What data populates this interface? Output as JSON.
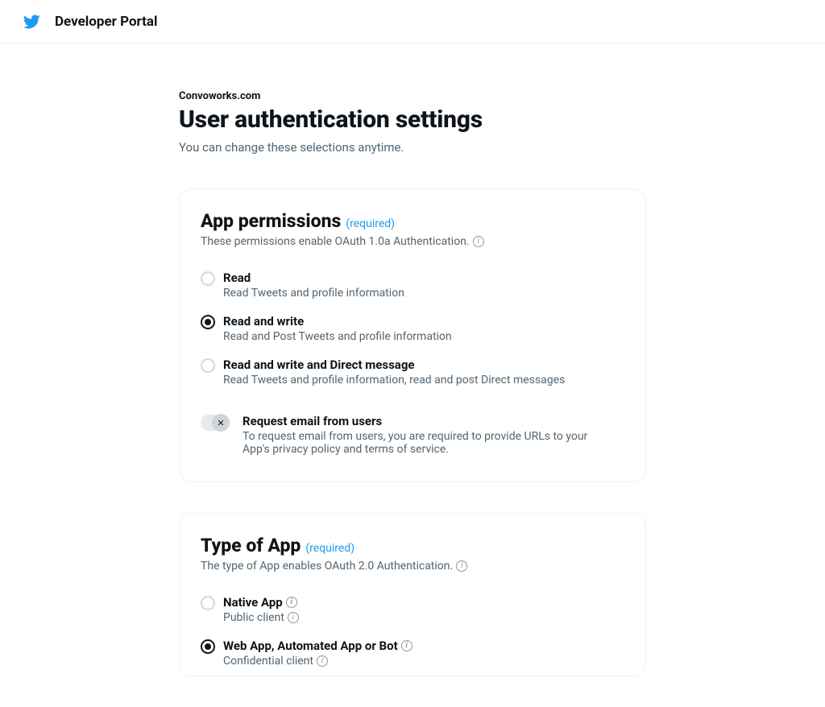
{
  "header": {
    "portal_title": "Developer Portal"
  },
  "page": {
    "breadcrumb": "Convoworks.com",
    "title": "User authentication settings",
    "subtitle": "You can change these selections anytime."
  },
  "sections": {
    "app_permissions": {
      "title": "App permissions",
      "required": "(required)",
      "description": "These permissions enable OAuth 1.0a Authentication.",
      "options": [
        {
          "label": "Read",
          "description": "Read Tweets and profile information",
          "selected": false
        },
        {
          "label": "Read and write",
          "description": "Read and Post Tweets and profile information",
          "selected": true
        },
        {
          "label": "Read and write and Direct message",
          "description": "Read Tweets and profile information, read and post Direct messages",
          "selected": false
        }
      ],
      "email_toggle": {
        "label": "Request email from users",
        "description": "To request email from users, you are required to provide URLs to your App's privacy policy and terms of service.",
        "enabled": false
      }
    },
    "type_of_app": {
      "title": "Type of App",
      "required": "(required)",
      "description": "The type of App enables OAuth 2.0 Authentication.",
      "options": [
        {
          "label": "Native App",
          "description": "Public client",
          "selected": false
        },
        {
          "label": "Web App, Automated App or Bot",
          "description": "Confidential client",
          "selected": true
        }
      ]
    }
  }
}
